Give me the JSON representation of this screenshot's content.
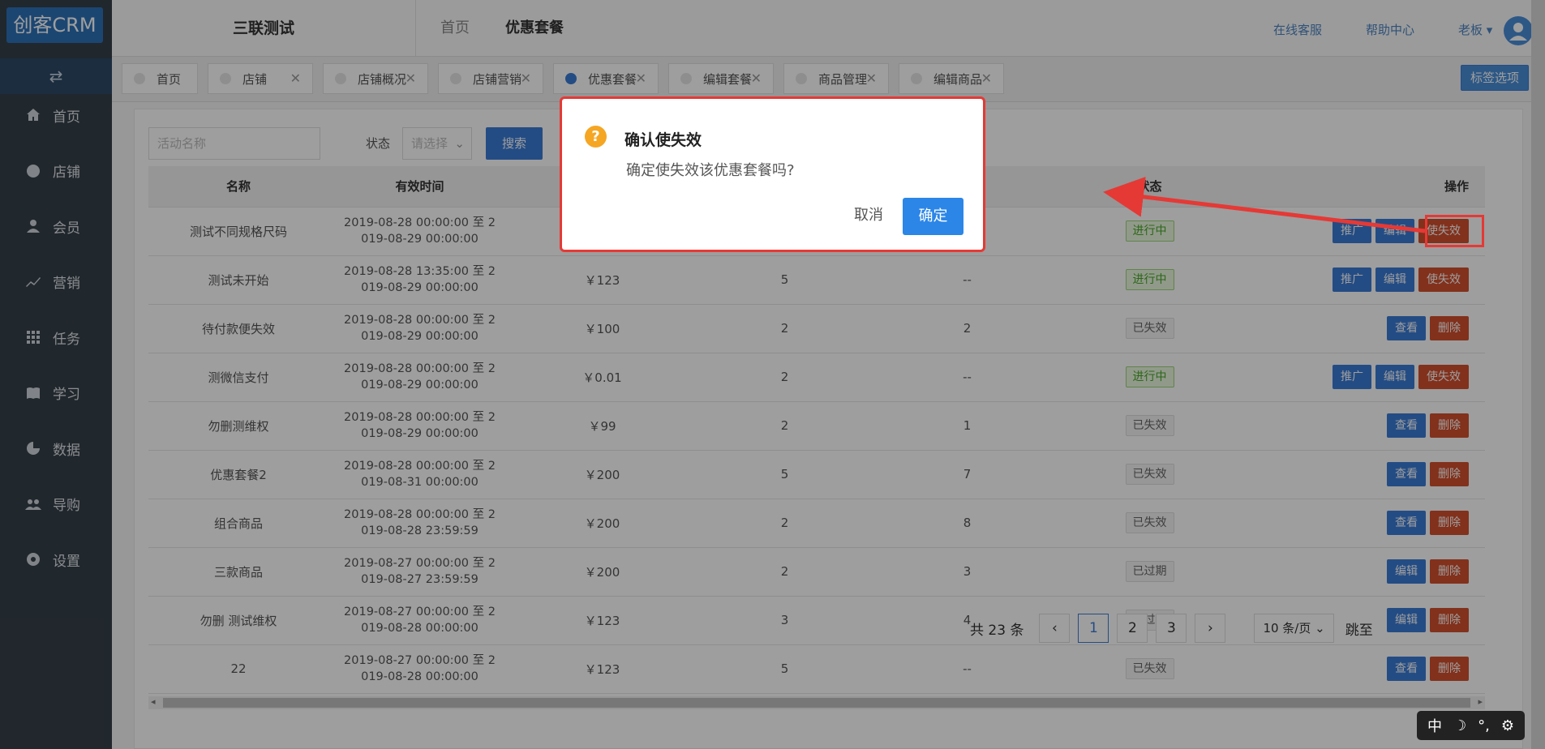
{
  "app": {
    "logo": "创客CRM",
    "switch_icon": "⇄"
  },
  "sidebar": {
    "items": [
      {
        "label": "首页",
        "icon": "home-icon"
      },
      {
        "label": "店铺",
        "icon": "store-icon"
      },
      {
        "label": "会员",
        "icon": "user-icon"
      },
      {
        "label": "营销",
        "icon": "trend-icon"
      },
      {
        "label": "任务",
        "icon": "grid-icon"
      },
      {
        "label": "学习",
        "icon": "book-icon"
      },
      {
        "label": "数据",
        "icon": "pie-icon"
      },
      {
        "label": "导购",
        "icon": "group-icon"
      },
      {
        "label": "设置",
        "icon": "gear-icon"
      }
    ]
  },
  "header": {
    "shop_name": "三联测试",
    "crumb_home": "首页",
    "crumb_current": "优惠套餐",
    "links": [
      "在线客服",
      "帮助中心",
      "老板 ▾"
    ]
  },
  "tabs": [
    {
      "label": "首页",
      "closable": false
    },
    {
      "label": "店铺",
      "closable": true
    },
    {
      "label": "店铺概况",
      "closable": true
    },
    {
      "label": "店铺营销",
      "closable": true
    },
    {
      "label": "优惠套餐",
      "closable": true,
      "active": true
    },
    {
      "label": "编辑套餐",
      "closable": true
    },
    {
      "label": "商品管理",
      "closable": true
    },
    {
      "label": "编辑商品",
      "closable": true
    }
  ],
  "tag_options_label": "标签选项",
  "filter": {
    "name_placeholder": "活动名称",
    "status_label": "状态",
    "status_placeholder": "请选择",
    "search_label": "搜索"
  },
  "table": {
    "columns": [
      "名称",
      "有效时间",
      "",
      "",
      "",
      "状态",
      "操作"
    ],
    "rows": [
      {
        "name": "测试不同规格尺码",
        "time": [
          "2019-08-28 00:00:00 至 2",
          "019-08-29 00:00:00"
        ],
        "price": "",
        "n1": "",
        "n2": "",
        "status": "进行中",
        "status_ok": true,
        "ops": [
          "推广",
          "编辑",
          "使失效"
        ]
      },
      {
        "name": "测试未开始",
        "time": [
          "2019-08-28 13:35:00 至 2",
          "019-08-29 00:00:00"
        ],
        "price": "￥123",
        "n1": "5",
        "n2": "--",
        "status": "进行中",
        "status_ok": true,
        "ops": [
          "推广",
          "编辑",
          "使失效"
        ]
      },
      {
        "name": "待付款便失效",
        "time": [
          "2019-08-28 00:00:00 至 2",
          "019-08-29 00:00:00"
        ],
        "price": "￥100",
        "n1": "2",
        "n2": "2",
        "status": "已失效",
        "status_ok": false,
        "ops": [
          "查看",
          "删除"
        ]
      },
      {
        "name": "测微信支付",
        "time": [
          "2019-08-28 00:00:00 至 2",
          "019-08-29 00:00:00"
        ],
        "price": "￥0.01",
        "n1": "2",
        "n2": "--",
        "status": "进行中",
        "status_ok": true,
        "ops": [
          "推广",
          "编辑",
          "使失效"
        ]
      },
      {
        "name": "勿删测维权",
        "time": [
          "2019-08-28 00:00:00 至 2",
          "019-08-29 00:00:00"
        ],
        "price": "￥99",
        "n1": "2",
        "n2": "1",
        "status": "已失效",
        "status_ok": false,
        "ops": [
          "查看",
          "删除"
        ]
      },
      {
        "name": "优惠套餐2",
        "time": [
          "2019-08-28 00:00:00 至 2",
          "019-08-31 00:00:00"
        ],
        "price": "￥200",
        "n1": "5",
        "n2": "7",
        "status": "已失效",
        "status_ok": false,
        "ops": [
          "查看",
          "删除"
        ]
      },
      {
        "name": "组合商品",
        "time": [
          "2019-08-28 00:00:00 至 2",
          "019-08-28 23:59:59"
        ],
        "price": "￥200",
        "n1": "2",
        "n2": "8",
        "status": "已失效",
        "status_ok": false,
        "ops": [
          "查看",
          "删除"
        ]
      },
      {
        "name": "三款商品",
        "time": [
          "2019-08-27 00:00:00 至 2",
          "019-08-27 23:59:59"
        ],
        "price": "￥200",
        "n1": "2",
        "n2": "3",
        "status": "已过期",
        "status_ok": false,
        "ops": [
          "编辑",
          "删除"
        ]
      },
      {
        "name": "勿删 测试维权",
        "time": [
          "2019-08-27 00:00:00 至 2",
          "019-08-28 00:00:00"
        ],
        "price": "￥123",
        "n1": "3",
        "n2": "4",
        "status": "已过期",
        "status_ok": false,
        "ops": [
          "编辑",
          "删除"
        ]
      },
      {
        "name": "22",
        "time": [
          "2019-08-27 00:00:00 至 2",
          "019-08-28 00:00:00"
        ],
        "price": "￥123",
        "n1": "5",
        "n2": "--",
        "status": "已失效",
        "status_ok": false,
        "ops": [
          "查看",
          "删除"
        ]
      }
    ]
  },
  "pagination": {
    "total": "共 23 条",
    "prev": "‹",
    "pages": [
      "1",
      "2",
      "3"
    ],
    "current": "1",
    "next": "›",
    "page_size": "10 条/页 ⌄",
    "jump_label": "跳至"
  },
  "dialog": {
    "icon": "?",
    "title": "确认使失效",
    "message": "确定使失效该优惠套餐吗?",
    "cancel": "取消",
    "confirm": "确定"
  },
  "ime": {
    "items": [
      "中",
      "☽",
      "°,",
      "⚙"
    ]
  },
  "colors": {
    "primary": "#3a7bd5",
    "danger": "#d24f2e",
    "sidebar": "#353f49",
    "highlight": "#e53935"
  }
}
